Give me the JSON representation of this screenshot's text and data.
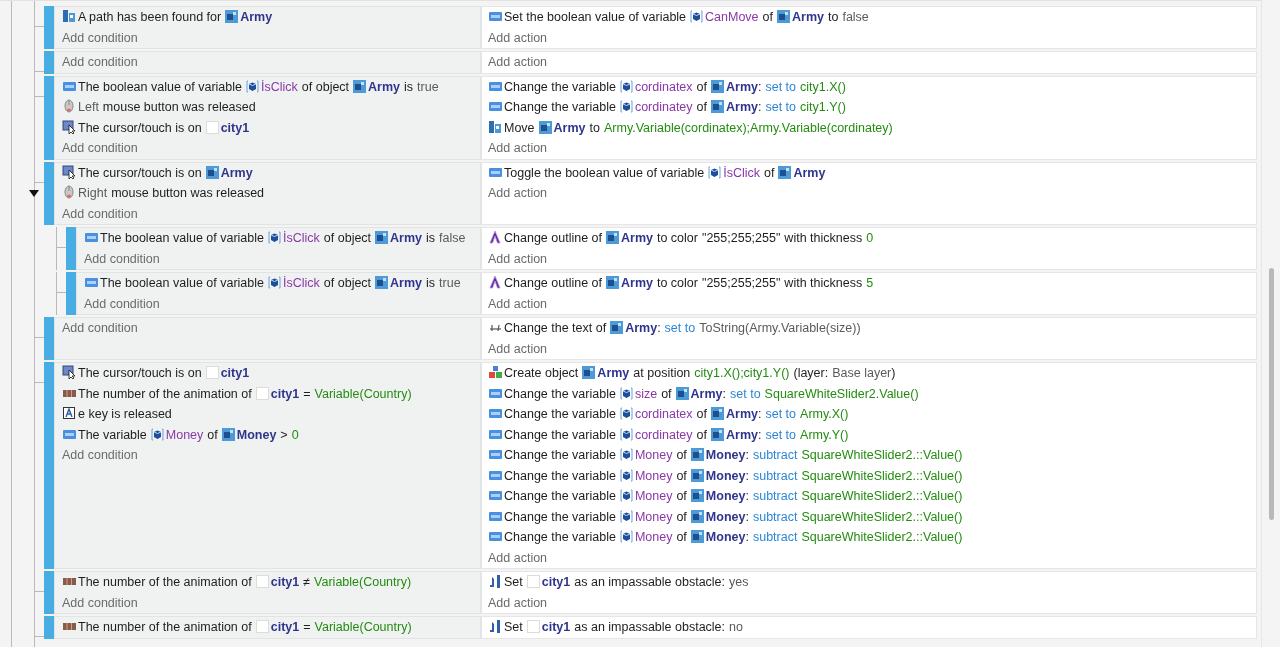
{
  "events": [
    {
      "conditions": [
        {
          "kind": "pathfinding",
          "parts": [
            {
              "kind": "text",
              "s": "A path has been found for"
            },
            {
              "kind": "object",
              "s": "Army"
            }
          ]
        }
      ],
      "actions": [
        {
          "kind": "variable",
          "parts": [
            {
              "kind": "text",
              "s": "Set the boolean value of variable"
            },
            {
              "kind": "variable",
              "s": "CanMove"
            },
            {
              "kind": "text",
              "s": "of"
            },
            {
              "kind": "object",
              "s": "Army"
            },
            {
              "kind": "text",
              "s": "to"
            },
            {
              "kind": "value",
              "s": "false"
            }
          ]
        }
      ],
      "add_condition": "Add condition",
      "add_action": "Add action"
    },
    {
      "add_condition": "Add condition",
      "add_action": "Add action"
    },
    {
      "conditions": [
        {
          "kind": "variable",
          "parts": [
            {
              "kind": "text",
              "s": "The boolean value of variable"
            },
            {
              "kind": "variable",
              "s": "İsClick"
            },
            {
              "kind": "text",
              "s": "of object"
            },
            {
              "kind": "object",
              "s": "Army"
            },
            {
              "kind": "text",
              "s": "is"
            },
            {
              "kind": "value",
              "s": "true"
            }
          ]
        },
        {
          "kind": "mouse",
          "parts": [
            {
              "kind": "value",
              "s": "Left"
            },
            {
              "kind": "text",
              "s": "mouse button was released"
            }
          ]
        },
        {
          "kind": "cursor",
          "parts": [
            {
              "kind": "text",
              "s": "The cursor/touch is on"
            },
            {
              "kind": "blank_object",
              "s": "city1"
            }
          ]
        }
      ],
      "actions": [
        {
          "kind": "variable",
          "parts": [
            {
              "kind": "text",
              "s": "Change the variable"
            },
            {
              "kind": "variable",
              "s": "cordinatex"
            },
            {
              "kind": "text",
              "s": "of"
            },
            {
              "kind": "object",
              "s": "Army"
            },
            {
              "kind": "punctuation",
              "s": ":"
            },
            {
              "kind": "operation",
              "s": "set to"
            },
            {
              "kind": "expression",
              "s": "city1.X()"
            }
          ]
        },
        {
          "kind": "variable",
          "parts": [
            {
              "kind": "text",
              "s": "Change the variable"
            },
            {
              "kind": "variable",
              "s": "cordinatey"
            },
            {
              "kind": "text",
              "s": "of"
            },
            {
              "kind": "object",
              "s": "Army"
            },
            {
              "kind": "punctuation",
              "s": ":"
            },
            {
              "kind": "operation",
              "s": "set to"
            },
            {
              "kind": "expression",
              "s": "city1.Y()"
            }
          ]
        },
        {
          "kind": "pathfinding",
          "parts": [
            {
              "kind": "text",
              "s": "Move"
            },
            {
              "kind": "object",
              "s": "Army"
            },
            {
              "kind": "text",
              "s": "to"
            },
            {
              "kind": "expression",
              "s": "Army.Variable(cordinatex);Army.Variable(cordinatey)"
            }
          ]
        }
      ],
      "add_condition": "Add condition",
      "add_action": "Add action"
    },
    {
      "expanded": true,
      "conditions": [
        {
          "kind": "cursor",
          "parts": [
            {
              "kind": "text",
              "s": "The cursor/touch is on"
            },
            {
              "kind": "object",
              "s": "Army"
            }
          ]
        },
        {
          "kind": "mouse",
          "parts": [
            {
              "kind": "value",
              "s": "Right"
            },
            {
              "kind": "text",
              "s": "mouse button was released"
            }
          ]
        }
      ],
      "actions": [
        {
          "kind": "variable",
          "parts": [
            {
              "kind": "text",
              "s": "Toggle the boolean value of variable"
            },
            {
              "kind": "variable",
              "s": "İsClick"
            },
            {
              "kind": "text",
              "s": "of"
            },
            {
              "kind": "object",
              "s": "Army"
            }
          ]
        }
      ],
      "add_condition": "Add condition",
      "add_action": "Add action",
      "children": [
        {
          "conditions": [
            {
              "kind": "variable",
              "parts": [
                {
                  "kind": "text",
                  "s": "The boolean value of variable"
                },
                {
                  "kind": "variable",
                  "s": "İsClick"
                },
                {
                  "kind": "text",
                  "s": "of object"
                },
                {
                  "kind": "object",
                  "s": "Army"
                },
                {
                  "kind": "text",
                  "s": "is"
                },
                {
                  "kind": "value",
                  "s": "false"
                }
              ]
            }
          ],
          "actions": [
            {
              "kind": "outline",
              "parts": [
                {
                  "kind": "text",
                  "s": "Change outline of"
                },
                {
                  "kind": "object",
                  "s": "Army"
                },
                {
                  "kind": "text",
                  "s": "to color"
                },
                {
                  "kind": "text",
                  "s": "\"255;255;255\""
                },
                {
                  "kind": "text",
                  "s": "with thickness"
                },
                {
                  "kind": "expression",
                  "s": "0"
                }
              ]
            }
          ],
          "add_condition": "Add condition",
          "add_action": "Add action"
        },
        {
          "conditions": [
            {
              "kind": "variable",
              "parts": [
                {
                  "kind": "text",
                  "s": "The boolean value of variable"
                },
                {
                  "kind": "variable",
                  "s": "İsClick"
                },
                {
                  "kind": "text",
                  "s": "of object"
                },
                {
                  "kind": "object",
                  "s": "Army"
                },
                {
                  "kind": "text",
                  "s": "is"
                },
                {
                  "kind": "value",
                  "s": "true"
                }
              ]
            }
          ],
          "actions": [
            {
              "kind": "outline",
              "parts": [
                {
                  "kind": "text",
                  "s": "Change outline of"
                },
                {
                  "kind": "object",
                  "s": "Army"
                },
                {
                  "kind": "text",
                  "s": "to color"
                },
                {
                  "kind": "text",
                  "s": "\"255;255;255\""
                },
                {
                  "kind": "text",
                  "s": "with thickness"
                },
                {
                  "kind": "expression",
                  "s": "5"
                }
              ]
            }
          ],
          "add_condition": "Add condition",
          "add_action": "Add action"
        }
      ]
    },
    {
      "actions": [
        {
          "kind": "text",
          "parts": [
            {
              "kind": "text",
              "s": "Change the text of"
            },
            {
              "kind": "object",
              "s": "Army"
            },
            {
              "kind": "punctuation",
              "s": ":"
            },
            {
              "kind": "operation",
              "s": "set to"
            },
            {
              "kind": "value",
              "s": "ToString(Army.Variable(size))"
            }
          ]
        }
      ],
      "add_condition": "Add condition",
      "add_action": "Add action"
    },
    {
      "conditions": [
        {
          "kind": "cursor",
          "parts": [
            {
              "kind": "text",
              "s": "The cursor/touch is on"
            },
            {
              "kind": "blank_object",
              "s": "city1"
            }
          ]
        },
        {
          "kind": "animation",
          "parts": [
            {
              "kind": "text",
              "s": "The number of the animation of"
            },
            {
              "kind": "blank_object",
              "s": "city1"
            },
            {
              "kind": "text",
              "s": "="
            },
            {
              "kind": "expression",
              "s": "Variable(Country)"
            }
          ]
        },
        {
          "kind": "keyboard",
          "parts": [
            {
              "kind": "text",
              "s": "e key is released"
            }
          ]
        },
        {
          "kind": "variable",
          "parts": [
            {
              "kind": "text",
              "s": "The variable"
            },
            {
              "kind": "variable",
              "s": "Money"
            },
            {
              "kind": "text",
              "s": "of"
            },
            {
              "kind": "object",
              "s": "Money"
            },
            {
              "kind": "text",
              "s": ">"
            },
            {
              "kind": "expression",
              "s": "0"
            }
          ]
        }
      ],
      "actions": [
        {
          "kind": "create",
          "parts": [
            {
              "kind": "text",
              "s": "Create object"
            },
            {
              "kind": "object",
              "s": "Army"
            },
            {
              "kind": "text",
              "s": "at position"
            },
            {
              "kind": "expression",
              "s": "city1.X();city1.Y()"
            },
            {
              "kind": "text",
              "s": "(layer:"
            },
            {
              "kind": "value",
              "s": "Base layer"
            },
            {
              "kind": "punctuation",
              "s": ")"
            }
          ]
        },
        {
          "kind": "variable",
          "parts": [
            {
              "kind": "text",
              "s": "Change the variable"
            },
            {
              "kind": "variable",
              "s": "size"
            },
            {
              "kind": "text",
              "s": "of"
            },
            {
              "kind": "object",
              "s": "Army"
            },
            {
              "kind": "punctuation",
              "s": ":"
            },
            {
              "kind": "operation",
              "s": "set to"
            },
            {
              "kind": "expression",
              "s": "SquareWhiteSlider2.Value()"
            }
          ]
        },
        {
          "kind": "variable",
          "parts": [
            {
              "kind": "text",
              "s": "Change the variable"
            },
            {
              "kind": "variable",
              "s": "cordinatex"
            },
            {
              "kind": "text",
              "s": "of"
            },
            {
              "kind": "object",
              "s": "Army"
            },
            {
              "kind": "punctuation",
              "s": ":"
            },
            {
              "kind": "operation",
              "s": "set to"
            },
            {
              "kind": "expression",
              "s": "Army.X()"
            }
          ]
        },
        {
          "kind": "variable",
          "parts": [
            {
              "kind": "text",
              "s": "Change the variable"
            },
            {
              "kind": "variable",
              "s": "cordinatey"
            },
            {
              "kind": "text",
              "s": "of"
            },
            {
              "kind": "object",
              "s": "Army"
            },
            {
              "kind": "punctuation",
              "s": ":"
            },
            {
              "kind": "operation",
              "s": "set to"
            },
            {
              "kind": "expression",
              "s": "Army.Y()"
            }
          ]
        },
        {
          "kind": "variable",
          "parts": [
            {
              "kind": "text",
              "s": "Change the variable"
            },
            {
              "kind": "variable",
              "s": "Money"
            },
            {
              "kind": "text",
              "s": "of"
            },
            {
              "kind": "object",
              "s": "Money"
            },
            {
              "kind": "punctuation",
              "s": ":"
            },
            {
              "kind": "operation",
              "s": "subtract"
            },
            {
              "kind": "expression",
              "s": "SquareWhiteSlider2.::Value()"
            }
          ]
        },
        {
          "kind": "variable",
          "parts": [
            {
              "kind": "text",
              "s": "Change the variable"
            },
            {
              "kind": "variable",
              "s": "Money"
            },
            {
              "kind": "text",
              "s": "of"
            },
            {
              "kind": "object",
              "s": "Money"
            },
            {
              "kind": "punctuation",
              "s": ":"
            },
            {
              "kind": "operation",
              "s": "subtract"
            },
            {
              "kind": "expression",
              "s": "SquareWhiteSlider2.::Value()"
            }
          ]
        },
        {
          "kind": "variable",
          "parts": [
            {
              "kind": "text",
              "s": "Change the variable"
            },
            {
              "kind": "variable",
              "s": "Money"
            },
            {
              "kind": "text",
              "s": "of"
            },
            {
              "kind": "object",
              "s": "Money"
            },
            {
              "kind": "punctuation",
              "s": ":"
            },
            {
              "kind": "operation",
              "s": "subtract"
            },
            {
              "kind": "expression",
              "s": "SquareWhiteSlider2.::Value()"
            }
          ]
        },
        {
          "kind": "variable",
          "parts": [
            {
              "kind": "text",
              "s": "Change the variable"
            },
            {
              "kind": "variable",
              "s": "Money"
            },
            {
              "kind": "text",
              "s": "of"
            },
            {
              "kind": "object",
              "s": "Money"
            },
            {
              "kind": "punctuation",
              "s": ":"
            },
            {
              "kind": "operation",
              "s": "subtract"
            },
            {
              "kind": "expression",
              "s": "SquareWhiteSlider2.::Value()"
            }
          ]
        },
        {
          "kind": "variable",
          "parts": [
            {
              "kind": "text",
              "s": "Change the variable"
            },
            {
              "kind": "variable",
              "s": "Money"
            },
            {
              "kind": "text",
              "s": "of"
            },
            {
              "kind": "object",
              "s": "Money"
            },
            {
              "kind": "punctuation",
              "s": ":"
            },
            {
              "kind": "operation",
              "s": "subtract"
            },
            {
              "kind": "expression",
              "s": "SquareWhiteSlider2.::Value()"
            }
          ]
        }
      ],
      "add_condition": "Add condition",
      "add_action": "Add action"
    },
    {
      "conditions": [
        {
          "kind": "animation",
          "parts": [
            {
              "kind": "text",
              "s": "The number of the animation of"
            },
            {
              "kind": "blank_object",
              "s": "city1"
            },
            {
              "kind": "text",
              "s": "≠"
            },
            {
              "kind": "expression",
              "s": "Variable(Country)"
            }
          ]
        }
      ],
      "actions": [
        {
          "kind": "obstacle",
          "parts": [
            {
              "kind": "text",
              "s": "Set"
            },
            {
              "kind": "blank_object",
              "s": "city1"
            },
            {
              "kind": "text",
              "s": "as an impassable obstacle:"
            },
            {
              "kind": "value",
              "s": "yes"
            }
          ]
        }
      ],
      "add_condition": "Add condition",
      "add_action": "Add action"
    },
    {
      "conditions": [
        {
          "kind": "animation",
          "parts": [
            {
              "kind": "text",
              "s": "The number of the animation of"
            },
            {
              "kind": "blank_object",
              "s": "city1"
            },
            {
              "kind": "text",
              "s": "="
            },
            {
              "kind": "expression",
              "s": "Variable(Country)"
            }
          ]
        }
      ],
      "actions": [
        {
          "kind": "obstacle",
          "parts": [
            {
              "kind": "text",
              "s": "Set"
            },
            {
              "kind": "blank_object",
              "s": "city1"
            },
            {
              "kind": "text",
              "s": "as an impassable obstacle:"
            },
            {
              "kind": "value",
              "s": "no"
            }
          ]
        }
      ]
    }
  ]
}
